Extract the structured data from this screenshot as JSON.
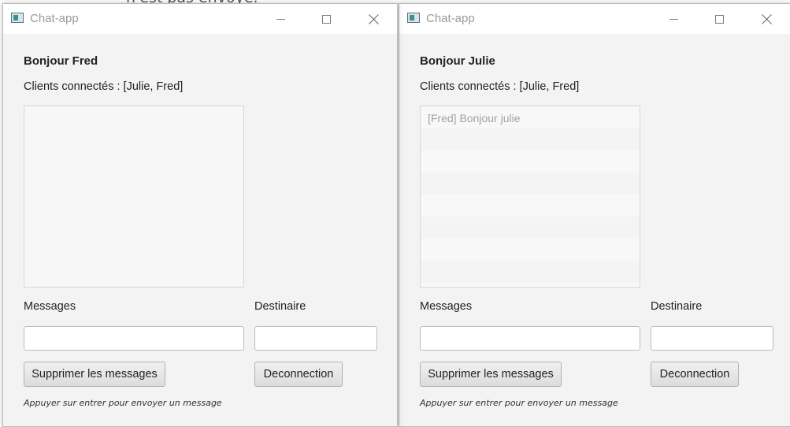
{
  "background": {
    "partial_text": "n'est pas envoyé."
  },
  "windows": [
    {
      "title": "Chat-app",
      "greeting": "Bonjour Fred",
      "clients": "Clients connectés : [Julie, Fred]",
      "messages": [],
      "messages_label": "Messages",
      "message_value": "",
      "destinataire_label": "Destinaire",
      "destinataire_value": "",
      "clear_button": "Supprimer les messages",
      "disconnect_button": "Deconnection",
      "hint": "Appuyer sur entrer pour envoyer un message"
    },
    {
      "title": "Chat-app",
      "greeting": "Bonjour Julie",
      "clients": "Clients connectés : [Julie, Fred]",
      "messages": [
        "[Fred] Bonjour julie"
      ],
      "messages_label": "Messages",
      "message_value": "",
      "destinataire_label": "Destinaire",
      "destinataire_value": "",
      "clear_button": "Supprimer les messages",
      "disconnect_button": "Deconnection",
      "hint": "Appuyer sur entrer pour envoyer un message"
    }
  ],
  "icons": {
    "app": "app-window-icon",
    "minimize": "minimize-icon",
    "maximize": "maximize-icon",
    "close": "close-icon"
  }
}
